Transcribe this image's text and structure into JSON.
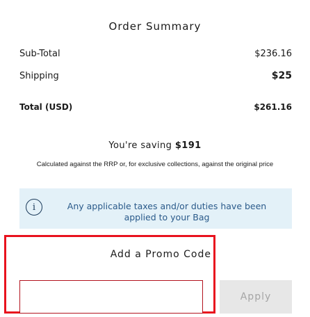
{
  "order_summary": {
    "title": "Order Summary",
    "subtotal_label": "Sub-Total",
    "subtotal_value": "$236.16",
    "shipping_label": "Shipping",
    "shipping_value": "$25",
    "total_label": "Total (USD)",
    "total_value": "$261.16"
  },
  "saving": {
    "prefix": "You're saving",
    "amount": "$191",
    "note": "Calculated against the RRP or, for exclusive collections, against the original price"
  },
  "info": {
    "icon": "info-icon",
    "glyph": "i",
    "text": "Any applicable taxes and/or duties have been applied to your Bag"
  },
  "promo": {
    "heading": "Add a Promo Code",
    "input_value": "",
    "apply_label": "Apply"
  },
  "colors": {
    "highlight": "#e8121e",
    "info_bg": "#e3f1f8",
    "info_text": "#2a5a8a"
  }
}
